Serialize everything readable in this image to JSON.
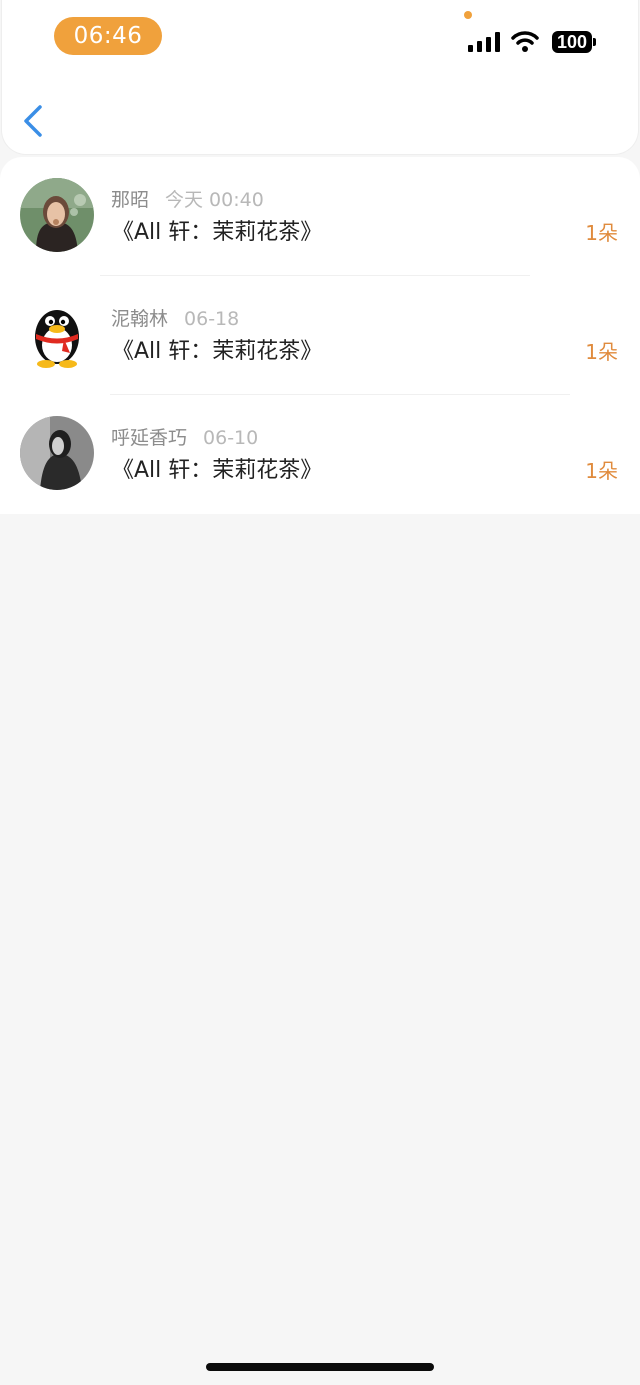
{
  "status_bar": {
    "time": "06:46",
    "battery": "100"
  },
  "nav": {
    "back_icon": "chevron-left-icon"
  },
  "rows": [
    {
      "name": "那昭",
      "time": "今天 00:40",
      "title": "《All 轩：茉莉花茶》",
      "count": "1朵"
    },
    {
      "name": "泥翰林",
      "time": "06-18",
      "title": "《All 轩：茉莉花茶》",
      "count": "1朵"
    },
    {
      "name": "呼延香巧",
      "time": "06-10",
      "title": "《All 轩：茉莉花茶》",
      "count": "1朵"
    }
  ],
  "colors": {
    "accent": "#f0a13c",
    "count": "#e08b3d",
    "back": "#3a8ee6"
  }
}
